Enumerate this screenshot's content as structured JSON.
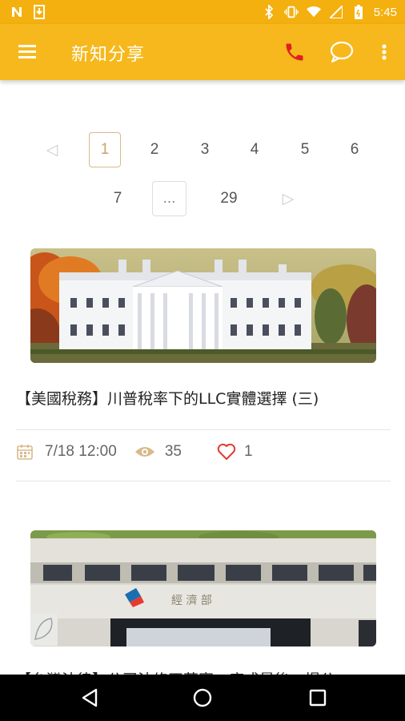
{
  "status_bar": {
    "time": "5:45",
    "icons": [
      "notification-n-icon",
      "download-icon",
      "bluetooth-icon",
      "vibrate-icon",
      "wifi-icon",
      "signal-icon",
      "battery-icon"
    ]
  },
  "app_bar": {
    "title": "新知分享",
    "icons": [
      "menu-icon",
      "phone-icon",
      "chat-icon",
      "more-vert-icon"
    ],
    "phone_color": "#e02020"
  },
  "pagination": {
    "prev": "◁",
    "next": "▷",
    "pages": [
      "1",
      "2",
      "3",
      "4",
      "5",
      "6",
      "7"
    ],
    "ellipsis": "...",
    "last": "29",
    "current": "1"
  },
  "articles": [
    {
      "title": "【美國稅務】川普稅率下的LLC實體選擇 (三)",
      "date": "7/18 12:00",
      "views": "35",
      "likes": "1",
      "image": "white-house-photo"
    },
    {
      "title": "【台灣法律】公司法修正草案，底成最後一提公",
      "image": "ministry-building-photo",
      "building_sign": "經 濟 部"
    }
  ],
  "colors": {
    "accent": "#f6b81c",
    "heart": "#e53935",
    "meta_icon": "#d9b98a"
  },
  "nav_bar": {
    "icons": [
      "back-icon",
      "home-icon",
      "recents-icon"
    ]
  }
}
